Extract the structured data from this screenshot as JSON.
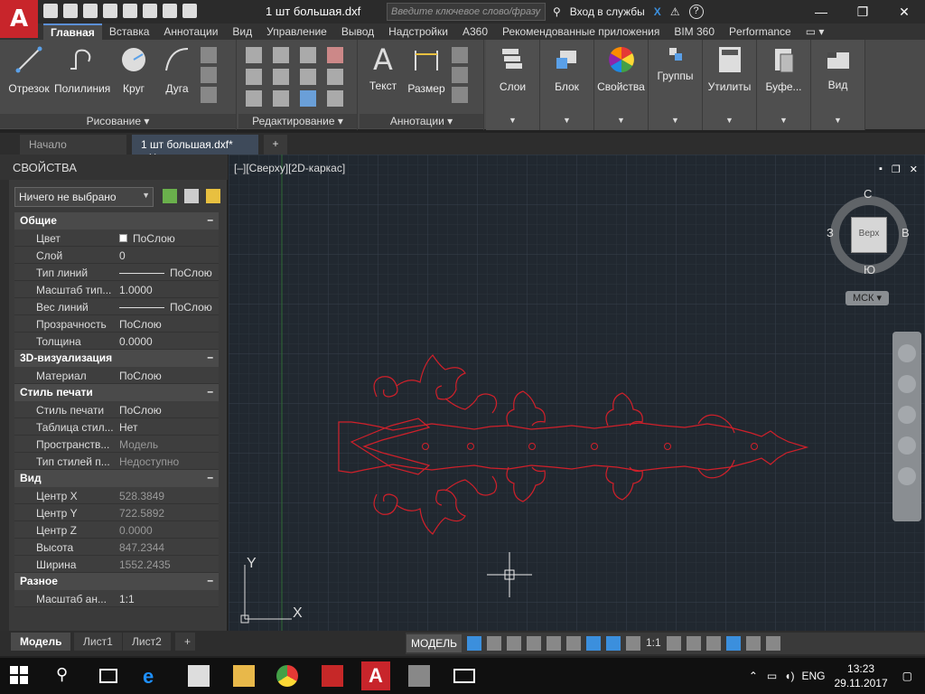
{
  "app": {
    "logo_letter": "A",
    "document_title": "1 шт большая.dxf",
    "search_placeholder": "Введите ключевое слово/фразу",
    "signin_label": "Вход в службы",
    "help_icon": "?"
  },
  "ribbon": {
    "tabs": [
      "Главная",
      "Вставка",
      "Аннотации",
      "Вид",
      "Управление",
      "Вывод",
      "Надстройки",
      "A360",
      "Рекомендованные приложения",
      "BIM 360",
      "Performance"
    ],
    "draw_group": {
      "title": "Рисование",
      "buttons": [
        "Отрезок",
        "Полилиния",
        "Круг",
        "Дуга"
      ]
    },
    "modify_group": {
      "title": "Редактирование"
    },
    "annotation_group": {
      "title": "Аннотации",
      "buttons": [
        "Текст",
        "Размер"
      ]
    },
    "big_buttons": [
      "Слои",
      "Блок",
      "Свойства",
      "Группы",
      "Утилиты",
      "Буфе...",
      "Вид"
    ]
  },
  "filetabs": {
    "start": "Начало",
    "current": "1 шт большая.dxf*",
    "add": "+"
  },
  "properties": {
    "title": "СВОЙСТВА",
    "selection": "Ничего не выбрано",
    "sections": [
      {
        "name": "Общие",
        "rows": [
          {
            "key": "Цвет",
            "value": "ПоСлою"
          },
          {
            "key": "Слой",
            "value": "0"
          },
          {
            "key": "Тип линий",
            "value": "ПоСлою"
          },
          {
            "key": "Масштаб тип...",
            "value": "1.0000"
          },
          {
            "key": "Вес линий",
            "value": "ПоСлою"
          },
          {
            "key": "Прозрачность",
            "value": "ПоСлою"
          },
          {
            "key": "Толщина",
            "value": "0.0000"
          }
        ]
      },
      {
        "name": "3D-визуализация",
        "rows": [
          {
            "key": "Материал",
            "value": "ПоСлою"
          }
        ]
      },
      {
        "name": "Стиль печати",
        "rows": [
          {
            "key": "Стиль печати",
            "value": "ПоСлою"
          },
          {
            "key": "Таблица стил...",
            "value": "Нет"
          },
          {
            "key": "Пространств...",
            "value": "Модель"
          },
          {
            "key": "Тип стилей п...",
            "value": "Недоступно"
          }
        ]
      },
      {
        "name": "Вид",
        "rows": [
          {
            "key": "Центр X",
            "value": "528.3849"
          },
          {
            "key": "Центр Y",
            "value": "722.5892"
          },
          {
            "key": "Центр Z",
            "value": "0.0000"
          },
          {
            "key": "Высота",
            "value": "847.2344"
          },
          {
            "key": "Ширина",
            "value": "1552.2435"
          }
        ]
      },
      {
        "name": "Разное",
        "rows": [
          {
            "key": "Масштаб ан...",
            "value": "1:1"
          }
        ]
      }
    ]
  },
  "viewport": {
    "label": "[–][Сверху][2D-каркас]",
    "viewcube": {
      "top": "Верх",
      "north": "С",
      "south": "Ю",
      "west": "З",
      "east": "В"
    },
    "wcs": "МСК",
    "axis_y": "Y",
    "axis_x": "X",
    "drawing_color": "#d0202a"
  },
  "layout_tabs": [
    "Модель",
    "Лист1",
    "Лист2"
  ],
  "statusbar": {
    "model": "МОДЕЛЬ",
    "scale": "1:1"
  },
  "taskbar": {
    "lang": "ENG",
    "time": "13:23",
    "date": "29.11.2017"
  }
}
